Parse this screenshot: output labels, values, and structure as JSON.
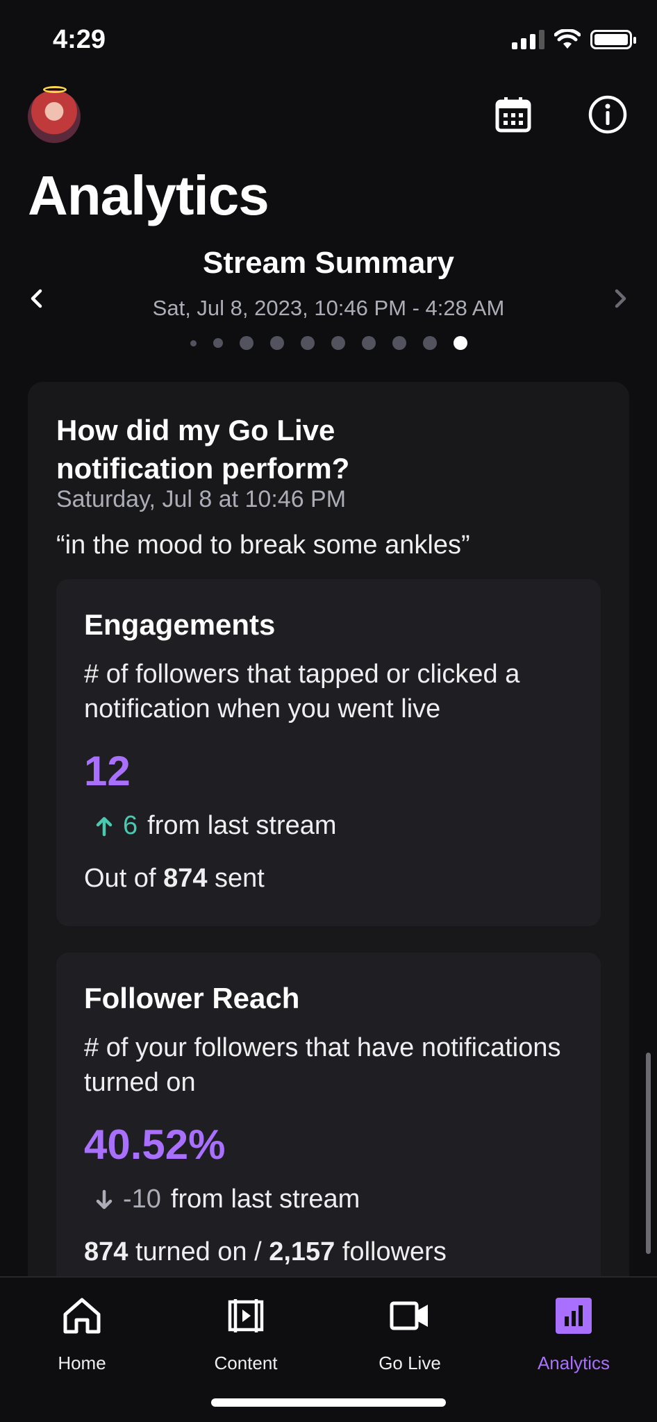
{
  "status_bar": {
    "time": "4:29"
  },
  "header": {
    "title": "Analytics",
    "calendar_icon": "calendar-icon",
    "info_icon": "info-icon"
  },
  "summary": {
    "title": "Stream Summary",
    "date_range": "Sat, Jul 8, 2023, 10:46 PM - 4:28 AM",
    "page_count": 10,
    "active_page": 10
  },
  "card": {
    "question": "How did my Go Live notification perform?",
    "date": "Saturday, Jul 8 at 10:46 PM",
    "quote": "“in the mood to break some ankles”",
    "engagements": {
      "title": "Engagements",
      "description": "# of followers that tapped or clicked a notification when you went live",
      "value": "12",
      "delta": "6",
      "delta_suffix": "from last stream",
      "out_of_prefix": "Out of",
      "out_of_value": "874",
      "out_of_suffix": "sent"
    },
    "reach": {
      "title": "Follower Reach",
      "description": "# of your followers that have notifications turned on",
      "value": "40.52%",
      "delta": "-10",
      "delta_suffix": "from last stream",
      "turned_on_value": "874",
      "turned_on_label": "turned on /",
      "followers_value": "2,157",
      "followers_label": "followers"
    }
  },
  "tabs": [
    {
      "label": "Home",
      "icon": "home-icon"
    },
    {
      "label": "Content",
      "icon": "content-icon"
    },
    {
      "label": "Go Live",
      "icon": "camera-icon"
    },
    {
      "label": "Analytics",
      "icon": "analytics-icon",
      "active": true
    }
  ],
  "colors": {
    "accent": "#a970ff",
    "up": "#48c9b0",
    "background": "#0e0e10",
    "card": "#18181b"
  }
}
